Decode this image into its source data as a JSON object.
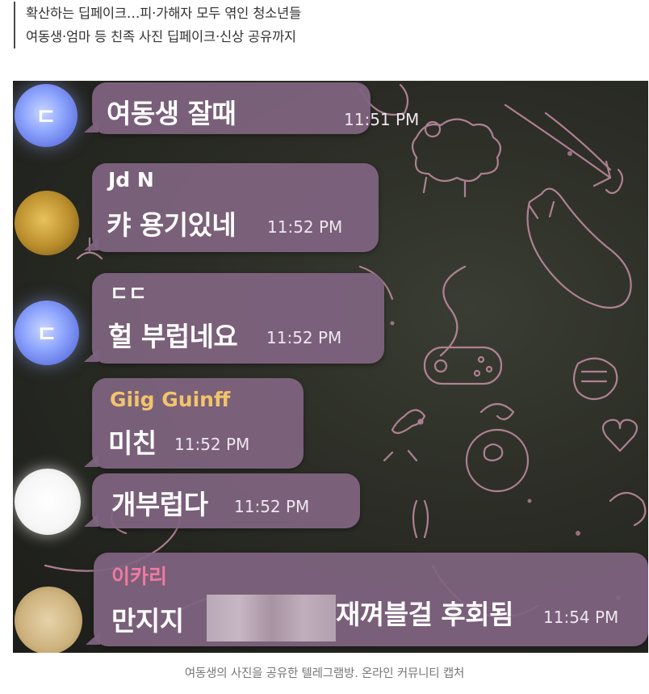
{
  "article": {
    "subtitle_lines": [
      "확산하는 딥페이크…피·가해자 모두 엮인 청소년들",
      "여동생·엄마 등 친족 사진 딥페이크·신상 공유까지"
    ],
    "caption": "여동생의 사진을 공유한 텔레그램방. 온라인 커뮤니티 캡처"
  },
  "chat": {
    "messages": [
      {
        "avatar_letter": "ㄷ",
        "sender": "",
        "text": "여동생 잘때",
        "time": "11:51 PM"
      },
      {
        "avatar_letter": "",
        "sender": "Jd N",
        "text": "캬 용기있네",
        "time": "11:52 PM"
      },
      {
        "avatar_letter": "ㄷ",
        "sender": "ㄷㄷ",
        "text": "헐 부럽네요",
        "time": "11:52 PM"
      },
      {
        "avatar_letter": "",
        "sender": "Giig Guinff",
        "text": "미친",
        "time": "11:52 PM"
      },
      {
        "avatar_letter": "",
        "sender": "",
        "text": "개부럽다",
        "time": "11:52 PM"
      },
      {
        "avatar_letter": "",
        "sender": "이카리",
        "text_before": "만지지",
        "text_after": "재껴블걸 후회됨",
        "time": "11:54 PM"
      }
    ]
  },
  "colors": {
    "bubble": "#806480",
    "sender_name_giig": "#f2c46b",
    "sender_name_ikari": "#f07aa0",
    "sender_name_default": "#ffffff",
    "background": "#2a2c25"
  }
}
